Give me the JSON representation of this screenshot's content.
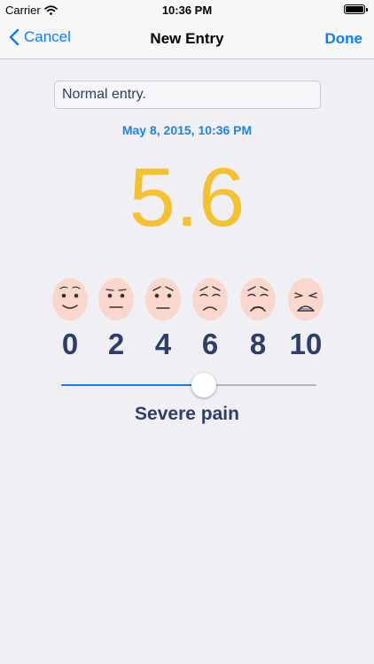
{
  "status_bar": {
    "carrier": "Carrier",
    "time": "10:36 PM"
  },
  "nav": {
    "cancel_label": "Cancel",
    "title": "New Entry",
    "done_label": "Done"
  },
  "entry": {
    "note_value": "Normal entry.",
    "date": "May 8, 2015, 10:36 PM",
    "score": "5.6",
    "pain_label": "Severe pain"
  },
  "scale": {
    "labels": [
      "0",
      "2",
      "4",
      "6",
      "8",
      "10"
    ],
    "faces": [
      "face-very-happy-icon",
      "face-neutral-icon",
      "face-worried-icon",
      "face-sad-icon",
      "face-very-sad-icon",
      "face-crying-icon"
    ]
  },
  "slider": {
    "min": 0,
    "max": 10,
    "value": 5.6
  },
  "colors": {
    "accent": "#0f7ef5",
    "score": "#f6c12f",
    "label": "#2c3e69",
    "date": "#1a86e6",
    "face": "#f9d7cd"
  }
}
